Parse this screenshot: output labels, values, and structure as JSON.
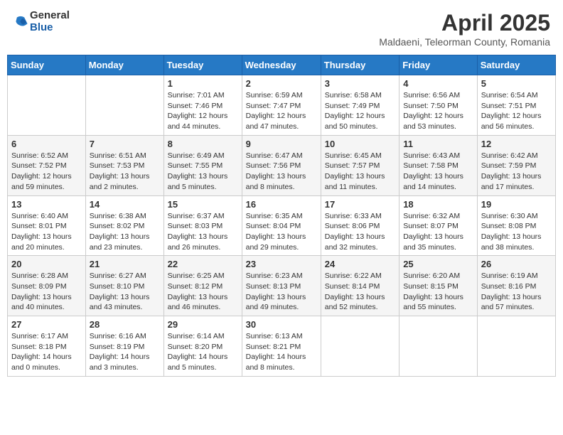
{
  "header": {
    "logo_general": "General",
    "logo_blue": "Blue",
    "month_title": "April 2025",
    "location": "Maldaeni, Teleorman County, Romania"
  },
  "weekdays": [
    "Sunday",
    "Monday",
    "Tuesday",
    "Wednesday",
    "Thursday",
    "Friday",
    "Saturday"
  ],
  "weeks": [
    [
      {
        "day": "",
        "info": ""
      },
      {
        "day": "",
        "info": ""
      },
      {
        "day": "1",
        "info": "Sunrise: 7:01 AM\nSunset: 7:46 PM\nDaylight: 12 hours and 44 minutes."
      },
      {
        "day": "2",
        "info": "Sunrise: 6:59 AM\nSunset: 7:47 PM\nDaylight: 12 hours and 47 minutes."
      },
      {
        "day": "3",
        "info": "Sunrise: 6:58 AM\nSunset: 7:49 PM\nDaylight: 12 hours and 50 minutes."
      },
      {
        "day": "4",
        "info": "Sunrise: 6:56 AM\nSunset: 7:50 PM\nDaylight: 12 hours and 53 minutes."
      },
      {
        "day": "5",
        "info": "Sunrise: 6:54 AM\nSunset: 7:51 PM\nDaylight: 12 hours and 56 minutes."
      }
    ],
    [
      {
        "day": "6",
        "info": "Sunrise: 6:52 AM\nSunset: 7:52 PM\nDaylight: 12 hours and 59 minutes."
      },
      {
        "day": "7",
        "info": "Sunrise: 6:51 AM\nSunset: 7:53 PM\nDaylight: 13 hours and 2 minutes."
      },
      {
        "day": "8",
        "info": "Sunrise: 6:49 AM\nSunset: 7:55 PM\nDaylight: 13 hours and 5 minutes."
      },
      {
        "day": "9",
        "info": "Sunrise: 6:47 AM\nSunset: 7:56 PM\nDaylight: 13 hours and 8 minutes."
      },
      {
        "day": "10",
        "info": "Sunrise: 6:45 AM\nSunset: 7:57 PM\nDaylight: 13 hours and 11 minutes."
      },
      {
        "day": "11",
        "info": "Sunrise: 6:43 AM\nSunset: 7:58 PM\nDaylight: 13 hours and 14 minutes."
      },
      {
        "day": "12",
        "info": "Sunrise: 6:42 AM\nSunset: 7:59 PM\nDaylight: 13 hours and 17 minutes."
      }
    ],
    [
      {
        "day": "13",
        "info": "Sunrise: 6:40 AM\nSunset: 8:01 PM\nDaylight: 13 hours and 20 minutes."
      },
      {
        "day": "14",
        "info": "Sunrise: 6:38 AM\nSunset: 8:02 PM\nDaylight: 13 hours and 23 minutes."
      },
      {
        "day": "15",
        "info": "Sunrise: 6:37 AM\nSunset: 8:03 PM\nDaylight: 13 hours and 26 minutes."
      },
      {
        "day": "16",
        "info": "Sunrise: 6:35 AM\nSunset: 8:04 PM\nDaylight: 13 hours and 29 minutes."
      },
      {
        "day": "17",
        "info": "Sunrise: 6:33 AM\nSunset: 8:06 PM\nDaylight: 13 hours and 32 minutes."
      },
      {
        "day": "18",
        "info": "Sunrise: 6:32 AM\nSunset: 8:07 PM\nDaylight: 13 hours and 35 minutes."
      },
      {
        "day": "19",
        "info": "Sunrise: 6:30 AM\nSunset: 8:08 PM\nDaylight: 13 hours and 38 minutes."
      }
    ],
    [
      {
        "day": "20",
        "info": "Sunrise: 6:28 AM\nSunset: 8:09 PM\nDaylight: 13 hours and 40 minutes."
      },
      {
        "day": "21",
        "info": "Sunrise: 6:27 AM\nSunset: 8:10 PM\nDaylight: 13 hours and 43 minutes."
      },
      {
        "day": "22",
        "info": "Sunrise: 6:25 AM\nSunset: 8:12 PM\nDaylight: 13 hours and 46 minutes."
      },
      {
        "day": "23",
        "info": "Sunrise: 6:23 AM\nSunset: 8:13 PM\nDaylight: 13 hours and 49 minutes."
      },
      {
        "day": "24",
        "info": "Sunrise: 6:22 AM\nSunset: 8:14 PM\nDaylight: 13 hours and 52 minutes."
      },
      {
        "day": "25",
        "info": "Sunrise: 6:20 AM\nSunset: 8:15 PM\nDaylight: 13 hours and 55 minutes."
      },
      {
        "day": "26",
        "info": "Sunrise: 6:19 AM\nSunset: 8:16 PM\nDaylight: 13 hours and 57 minutes."
      }
    ],
    [
      {
        "day": "27",
        "info": "Sunrise: 6:17 AM\nSunset: 8:18 PM\nDaylight: 14 hours and 0 minutes."
      },
      {
        "day": "28",
        "info": "Sunrise: 6:16 AM\nSunset: 8:19 PM\nDaylight: 14 hours and 3 minutes."
      },
      {
        "day": "29",
        "info": "Sunrise: 6:14 AM\nSunset: 8:20 PM\nDaylight: 14 hours and 5 minutes."
      },
      {
        "day": "30",
        "info": "Sunrise: 6:13 AM\nSunset: 8:21 PM\nDaylight: 14 hours and 8 minutes."
      },
      {
        "day": "",
        "info": ""
      },
      {
        "day": "",
        "info": ""
      },
      {
        "day": "",
        "info": ""
      }
    ]
  ]
}
